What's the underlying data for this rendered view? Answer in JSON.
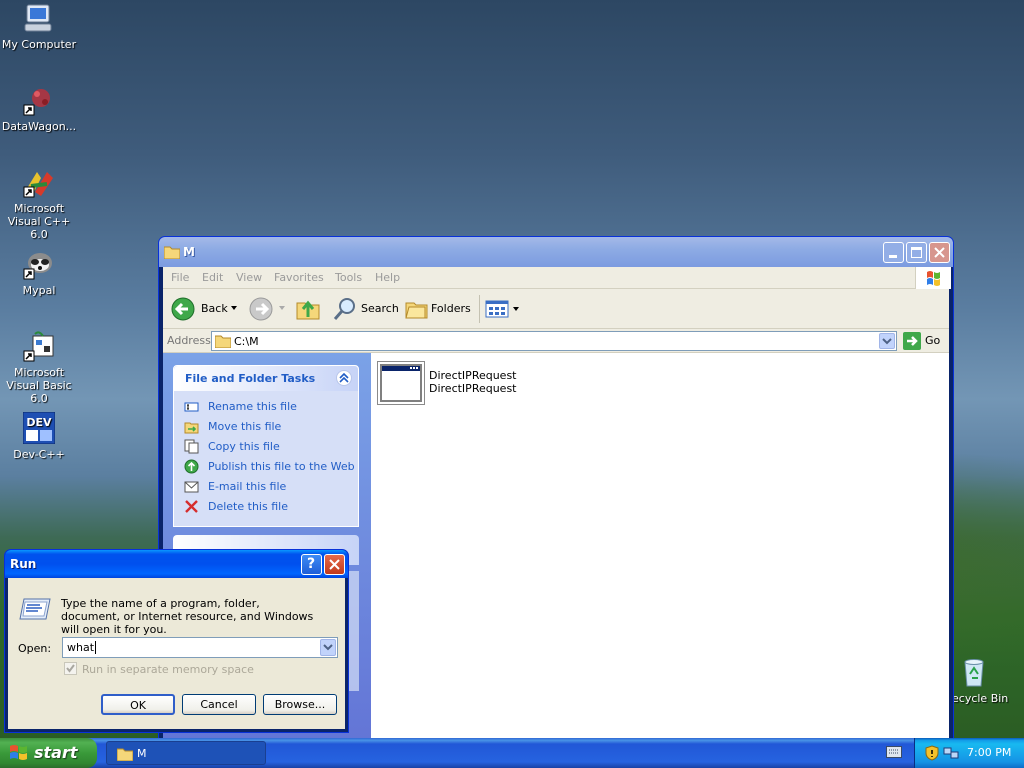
{
  "desktop": {
    "icons": [
      {
        "label": "My Computer",
        "icon": "my-computer-icon"
      },
      {
        "label": "DataWagon...",
        "icon": "datawagon-shortcut-icon"
      },
      {
        "label": "Microsoft Visual C++ 6.0",
        "icon": "visual-cpp-icon"
      },
      {
        "label": "Mypal",
        "icon": "mypal-raccoon-icon"
      },
      {
        "label": "Microsoft Visual Basic 6.0",
        "icon": "visual-basic-icon"
      },
      {
        "label": "Dev-C++",
        "icon": "dev-cpp-icon"
      },
      {
        "label": "ecycle Bin",
        "icon": "recycle-bin-icon"
      }
    ]
  },
  "explorer": {
    "title": "M",
    "menu": [
      "File",
      "Edit",
      "View",
      "Favorites",
      "Tools",
      "Help"
    ],
    "toolbar": {
      "back": "Back",
      "search": "Search",
      "folders": "Folders"
    },
    "address": {
      "label": "Address",
      "value": "C:\\M",
      "go": "Go"
    },
    "tasks": {
      "header": "File and Folder Tasks",
      "items": [
        {
          "label": "Rename this file",
          "icon": "rename-icon"
        },
        {
          "label": "Move this file",
          "icon": "move-icon"
        },
        {
          "label": "Copy this file",
          "icon": "copy-icon"
        },
        {
          "label": "Publish this file to the Web",
          "icon": "publish-web-icon"
        },
        {
          "label": "E-mail this file",
          "icon": "email-icon"
        },
        {
          "label": "Delete this file",
          "icon": "delete-icon"
        }
      ]
    },
    "file": {
      "name": "DirectIPRequest",
      "description": "DirectIPRequest",
      "icon": "application-window-icon"
    }
  },
  "run_dialog": {
    "title": "Run",
    "message": "Type the name of a program, folder, document, or Internet resource, and Windows will open it for you.",
    "open_label": "Open:",
    "input_value": "what ",
    "checkbox_label": "Run in separate memory space",
    "checkbox_checked": true,
    "buttons": {
      "ok": "OK",
      "cancel": "Cancel",
      "browse": "Browse..."
    }
  },
  "taskbar": {
    "start": "start",
    "items": [
      {
        "label": "M",
        "icon": "folder-icon"
      }
    ],
    "clock": "7:00 PM"
  },
  "colors": {
    "xp_blue": "#0054e3",
    "start_green": "#3a9a3a",
    "task_link": "#215dc6"
  }
}
